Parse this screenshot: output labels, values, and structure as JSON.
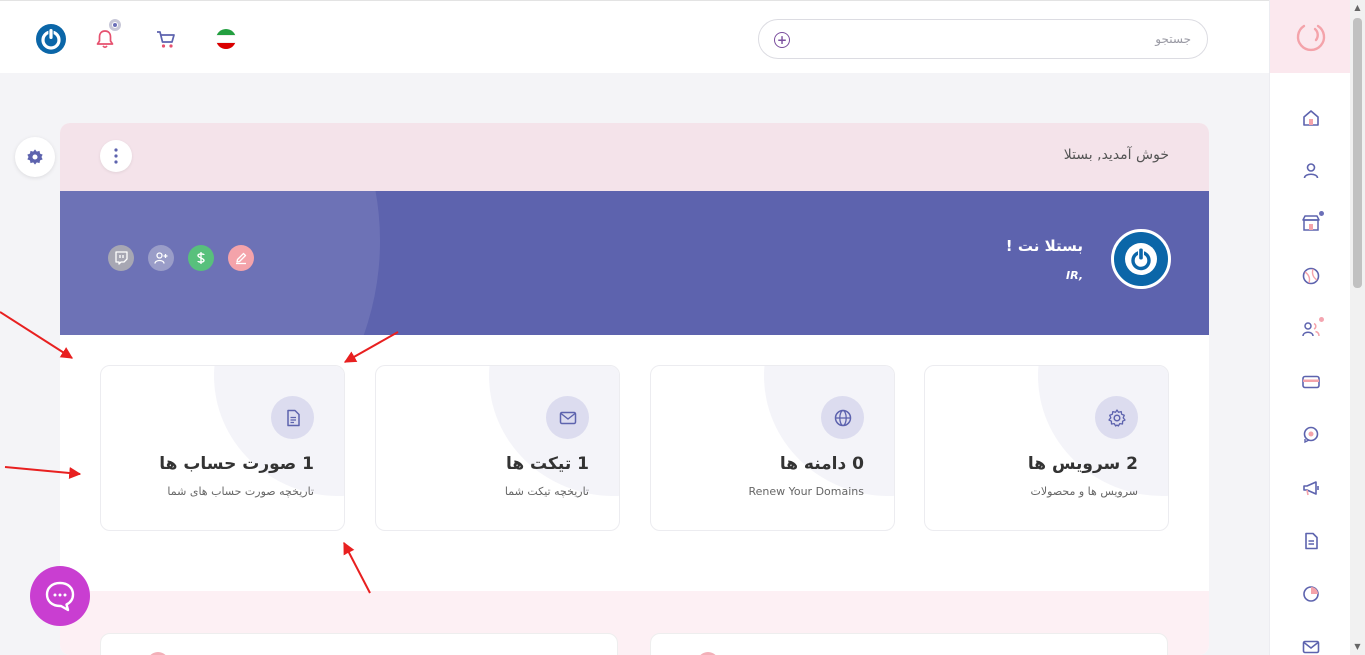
{
  "header": {
    "search_placeholder": "جستجو",
    "flag_colors": [
      "#239f40",
      "#ffffff",
      "#da0000"
    ],
    "accent": "#7b4f9e"
  },
  "sidebar": {
    "items": [
      {
        "icon": "home-icon"
      },
      {
        "icon": "user-icon"
      },
      {
        "icon": "store-icon",
        "badge_color": "#6b6fb8"
      },
      {
        "icon": "ball-icon"
      },
      {
        "icon": "users-icon",
        "badge_color": "#f4a5b0"
      },
      {
        "icon": "card-icon"
      },
      {
        "icon": "support-icon"
      },
      {
        "icon": "megaphone-icon"
      },
      {
        "icon": "document-icon"
      },
      {
        "icon": "pie-chart-icon"
      },
      {
        "icon": "mail-icon"
      }
    ]
  },
  "welcome": {
    "text": "خوش آمدید, بستلا"
  },
  "profile": {
    "name": "بستلا نت !",
    "subtitle": "IR,",
    "banner_color": "#5d63ae",
    "actions": [
      {
        "icon": "twitch-icon",
        "color": "#a7a7b3"
      },
      {
        "icon": "user-plus-icon",
        "color": "#9a9dc8"
      },
      {
        "icon": "dollar-icon",
        "color": "#58c07c"
      },
      {
        "icon": "edit-icon",
        "color": "#f4a3aa"
      }
    ]
  },
  "stats": [
    {
      "title": "2 سرویس ها",
      "desc": "سرویس ها و محصولات",
      "icon": "gear-icon"
    },
    {
      "title": "0 دامنه ها",
      "desc": "Renew Your Domains",
      "icon": "globe-icon"
    },
    {
      "title": "1 تیکت ها",
      "desc": "تاریخچه تیکت شما",
      "icon": "mail-icon"
    },
    {
      "title": "1 صورت حساب ها",
      "desc": "تاریخچه صورت حساب های شما",
      "icon": "invoice-icon"
    }
  ],
  "colors": {
    "chat": "#c93ed1",
    "annotation": "#e82020",
    "brand_blue": "#0b66a8"
  }
}
